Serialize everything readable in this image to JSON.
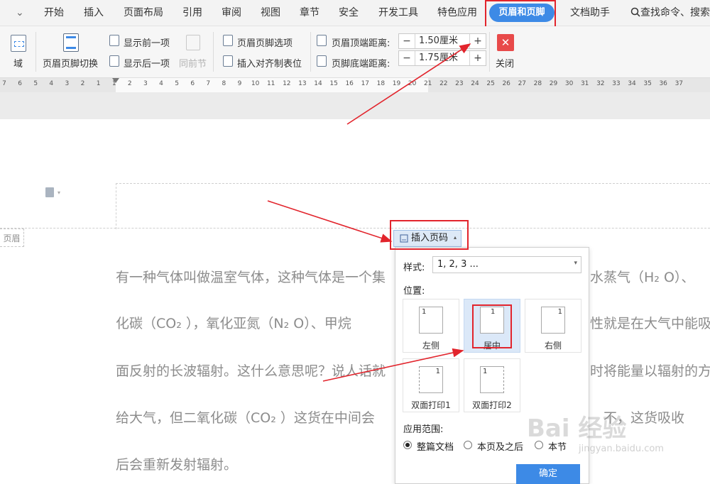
{
  "menubar": {
    "collapse_glyph": "⌄",
    "items": [
      "开始",
      "插入",
      "页面布局",
      "引用",
      "审阅",
      "视图",
      "章节",
      "安全",
      "开发工具",
      "特色应用"
    ],
    "active_tab": "页眉和页脚",
    "after_items": [
      "文档助手"
    ],
    "search": "查找命令、搜索"
  },
  "ribbon": {
    "field_label": "域",
    "switch_label": "页眉页脚切换",
    "show_prev": "显示前一项",
    "show_next": "显示后一项",
    "same_as_prev": "同前节",
    "hf_options": "页眉页脚选项",
    "insert_tab_stop": "插入对齐制表位",
    "header_top_label": "页眉顶端距离:",
    "header_top_value": "1.50厘米",
    "footer_bottom_label": "页脚底端距离:",
    "footer_bottom_value": "1.75厘米",
    "close_label": "关闭",
    "close_icon": "✕"
  },
  "ruler": {
    "ticks": [
      "7",
      "6",
      "5",
      "4",
      "3",
      "2",
      "1",
      "1",
      "2",
      "3",
      "4",
      "5",
      "6",
      "7",
      "8",
      "9",
      "10",
      "11",
      "12",
      "13",
      "14",
      "15",
      "16",
      "17",
      "18",
      "19",
      "20",
      "21",
      "22",
      "23",
      "24",
      "25",
      "26",
      "27",
      "28",
      "29",
      "30",
      "31",
      "32",
      "33",
      "34",
      "35",
      "36",
      "37"
    ]
  },
  "document": {
    "header_label": "页眉",
    "lines": [
      "有一种气体叫做温室气体，这种气体是一个集",
      "化碳（CO₂ ），氧化亚氮（N₂ O）、甲烷",
      "面反射的长波辐射。这什么意思呢？说人话就",
      "给大气，但二氧化碳（CO₂ ）这货在中间会",
      "后会重新发射辐射。"
    ],
    "right_fragments": [
      "水蒸气（H₂ O）、",
      "性就是在大气中能吸",
      "时将能量以辐射的方",
      "不，这货吸收"
    ]
  },
  "popup": {
    "insert_button": "插入页码",
    "style_label": "样式:",
    "style_value": "1, 2, 3 ...",
    "position_label": "位置:",
    "positions": [
      {
        "label": "左侧",
        "num": "1"
      },
      {
        "label": "居中",
        "num": "1"
      },
      {
        "label": "右侧",
        "num": "1"
      },
      {
        "label": "双面打印1",
        "num": "1"
      },
      {
        "label": "双面打印2",
        "num": "1"
      }
    ],
    "scope_label": "应用范围:",
    "scopes": [
      "整篇文档",
      "本页及之后",
      "本节"
    ],
    "selected_scope": "整篇文档",
    "ok_button": "确定"
  },
  "watermark": {
    "text": "Bai 经验",
    "sub": "jingyan.baidu.com"
  },
  "colors": {
    "accent": "#3d8ae6",
    "highlight_box": "#e2242c",
    "close_button": "#e84a4a"
  }
}
